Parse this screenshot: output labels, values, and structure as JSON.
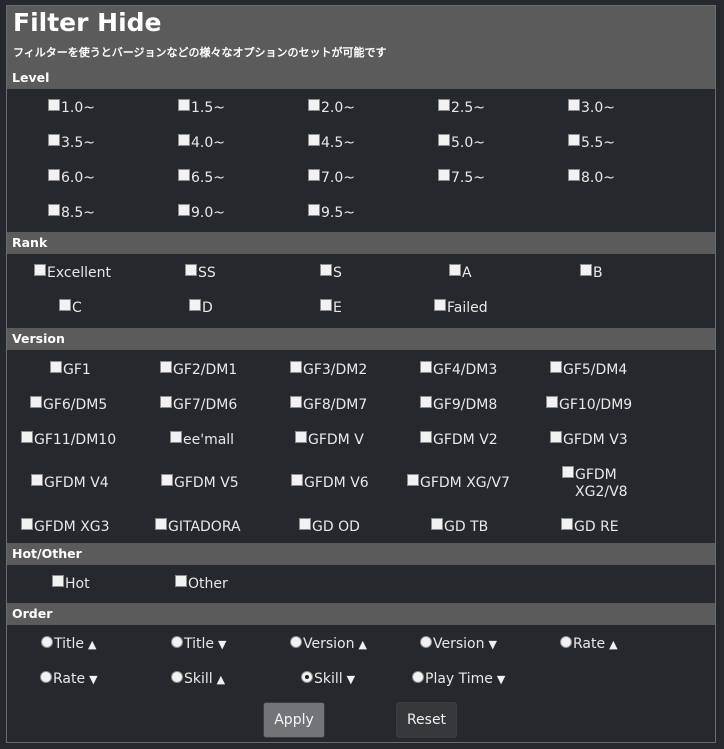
{
  "title": "Filter Hide",
  "subtitle": "フィルターを使うとバージョンなどの様々なオプションのセットが可能です",
  "level": {
    "header": "Level",
    "items": [
      "1.0~",
      "1.5~",
      "2.0~",
      "2.5~",
      "3.0~",
      "3.5~",
      "4.0~",
      "4.5~",
      "5.0~",
      "5.5~",
      "6.0~",
      "6.5~",
      "7.0~",
      "7.5~",
      "8.0~",
      "8.5~",
      "9.0~",
      "9.5~"
    ]
  },
  "rank": {
    "header": "Rank",
    "items": [
      "Excellent",
      "SS",
      "S",
      "A",
      "B",
      "C",
      "D",
      "E",
      "Failed"
    ]
  },
  "version": {
    "header": "Version",
    "items": [
      "GF1",
      "GF2/DM1",
      "GF3/DM2",
      "GF4/DM3",
      "GF5/DM4",
      "GF6/DM5",
      "GF7/DM6",
      "GF8/DM7",
      "GF9/DM8",
      "GF10/DM9",
      "GF11/DM10",
      "ee'mall",
      "GFDM V",
      "GFDM V2",
      "GFDM V3",
      "GFDM V4",
      "GFDM V5",
      "GFDM V6",
      "GFDM XG/V7",
      "GFDM XG2/V8",
      "GFDM XG3",
      "GITADORA",
      "GD OD",
      "GD TB",
      "GD RE"
    ],
    "wrapped_label": {
      "line1": "GFDM",
      "line2": "XG2/V8"
    }
  },
  "hot_other": {
    "header": "Hot/Other",
    "items": [
      "Hot",
      "Other"
    ]
  },
  "order": {
    "header": "Order",
    "items": [
      {
        "label": "Title",
        "arrow": "▲",
        "selected": false
      },
      {
        "label": "Title",
        "arrow": "▼",
        "selected": false
      },
      {
        "label": "Version",
        "arrow": "▲",
        "selected": false
      },
      {
        "label": "Version",
        "arrow": "▼",
        "selected": false
      },
      {
        "label": "Rate",
        "arrow": "▲",
        "selected": false
      },
      {
        "label": "Rate",
        "arrow": "▼",
        "selected": false
      },
      {
        "label": "Skill",
        "arrow": "▲",
        "selected": false
      },
      {
        "label": "Skill",
        "arrow": "▼",
        "selected": true
      },
      {
        "label": "Play Time",
        "arrow": "▼",
        "selected": false
      }
    ]
  },
  "buttons": {
    "apply": "Apply",
    "reset": "Reset"
  }
}
